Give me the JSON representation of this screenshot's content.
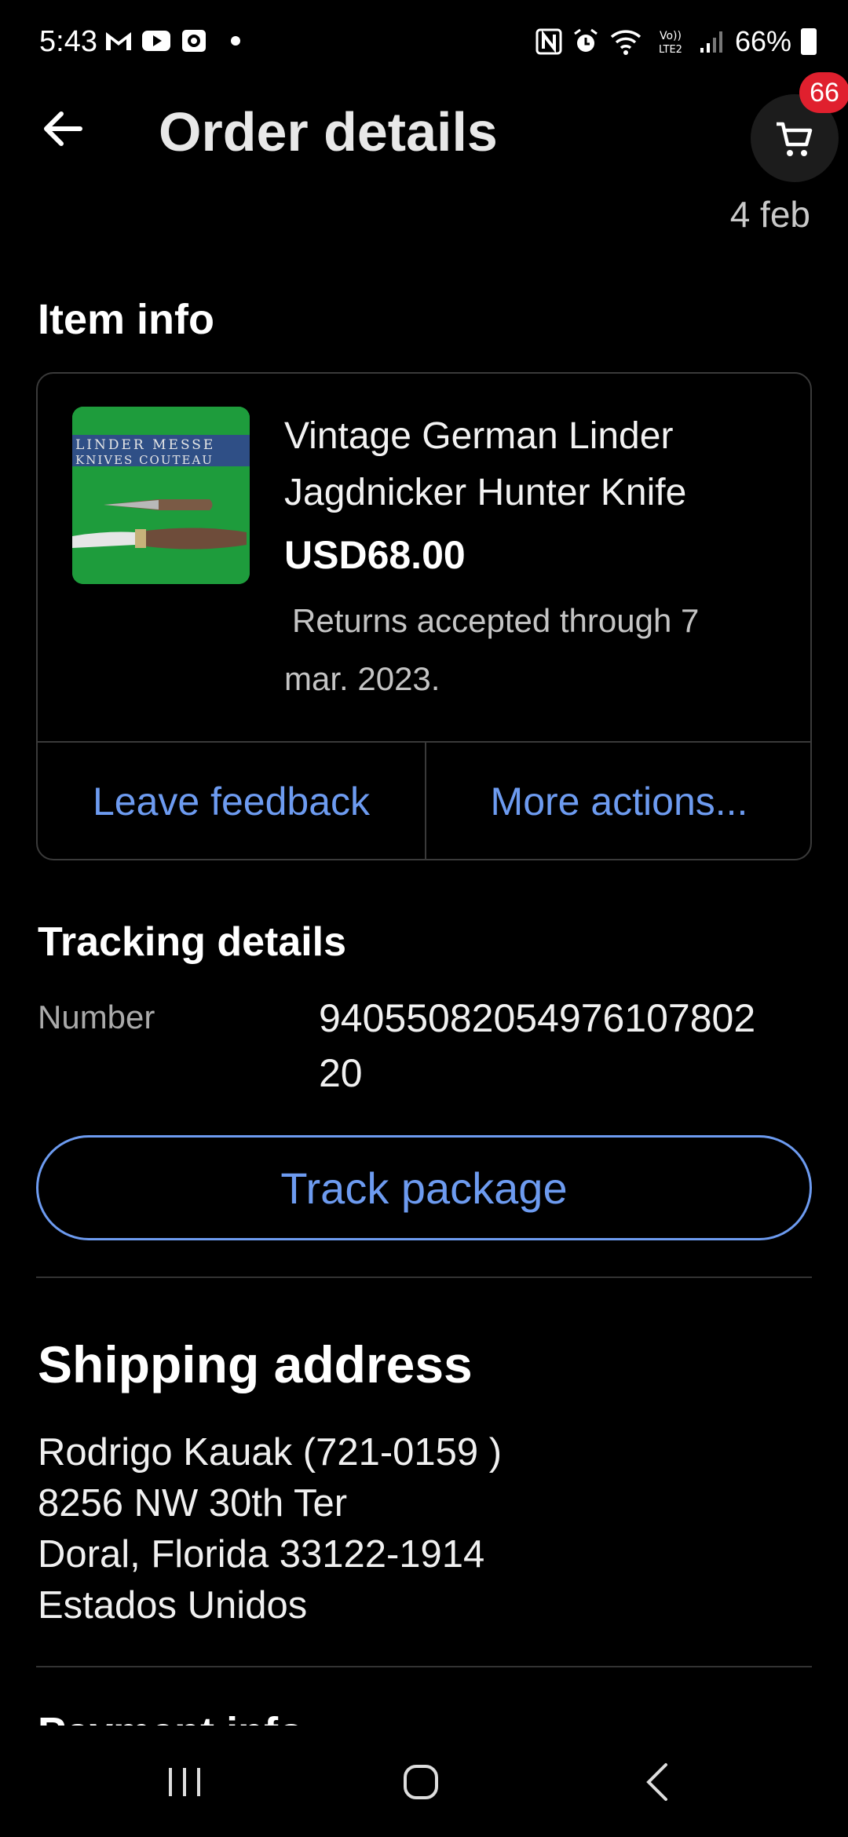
{
  "status_bar": {
    "time": "5:43",
    "battery": "66%",
    "left_icons": [
      "gmail-icon",
      "youtube-icon",
      "outlook-icon",
      "dot-icon"
    ],
    "right_icons": [
      "nfc-icon",
      "alarm-icon",
      "wifi-icon",
      "volte-icon",
      "signal-icon",
      "battery-icon"
    ]
  },
  "header": {
    "title": "Order details",
    "cart_count": "66"
  },
  "order_date": "4 feb",
  "item_info": {
    "section_title": "Item info",
    "title_line1": "Vintage German Linder",
    "title_line2": "Jagdnicker Hunter Knife",
    "price": "USD68.00",
    "returns_line1": "Returns accepted through 7",
    "returns_line2": "mar. 2023.",
    "leave_feedback": "Leave feedback",
    "more_actions": "More actions...",
    "thumb_text_line1": "LINDER MESSE",
    "thumb_text_line2": "KNIVES COUTEAU"
  },
  "tracking": {
    "section_title": "Tracking details",
    "number_label": "Number",
    "number_value": "940550820549761078022 0",
    "number_line1": "9405508205497610780 2",
    "track_button": "Track package"
  },
  "shipping": {
    "section_title": "Shipping address",
    "lines": [
      "Rodrigo Kauak (721-0159 )",
      "8256 NW 30th Ter",
      "Doral, Florida 33122-1914",
      "Estados Unidos"
    ]
  },
  "next_section_title": "Payment info",
  "colors": {
    "background": "#000000",
    "link": "#6d9bf0",
    "badge": "#e0202e"
  }
}
